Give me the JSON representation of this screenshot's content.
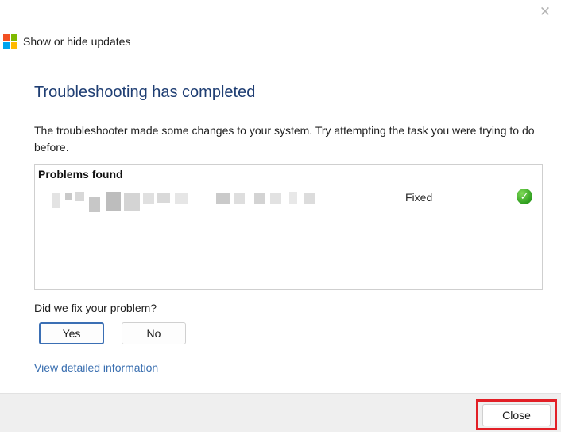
{
  "window": {
    "close_glyph": "✕",
    "app_title": "Show or hide updates",
    "logo_icon": "windows-logo-icon",
    "logo_colors": [
      "#f25022",
      "#7fba00",
      "#00a4ef",
      "#ffb900"
    ]
  },
  "main": {
    "heading": "Troubleshooting has completed",
    "description": "The troubleshooter made some changes to your system. Try attempting the task you were trying to do before.",
    "problems": {
      "header": "Problems found",
      "items": [
        {
          "status": "Fixed",
          "status_icon": "check-circle-icon"
        }
      ]
    },
    "question": "Did we fix your problem?",
    "yes_label": "Yes",
    "no_label": "No",
    "details_link": "View detailed information"
  },
  "footer": {
    "close_label": "Close"
  },
  "colors": {
    "heading": "#1f3e73",
    "link": "#3a6fb0",
    "highlight": "#e21f26",
    "check": "#2f9e1f"
  }
}
